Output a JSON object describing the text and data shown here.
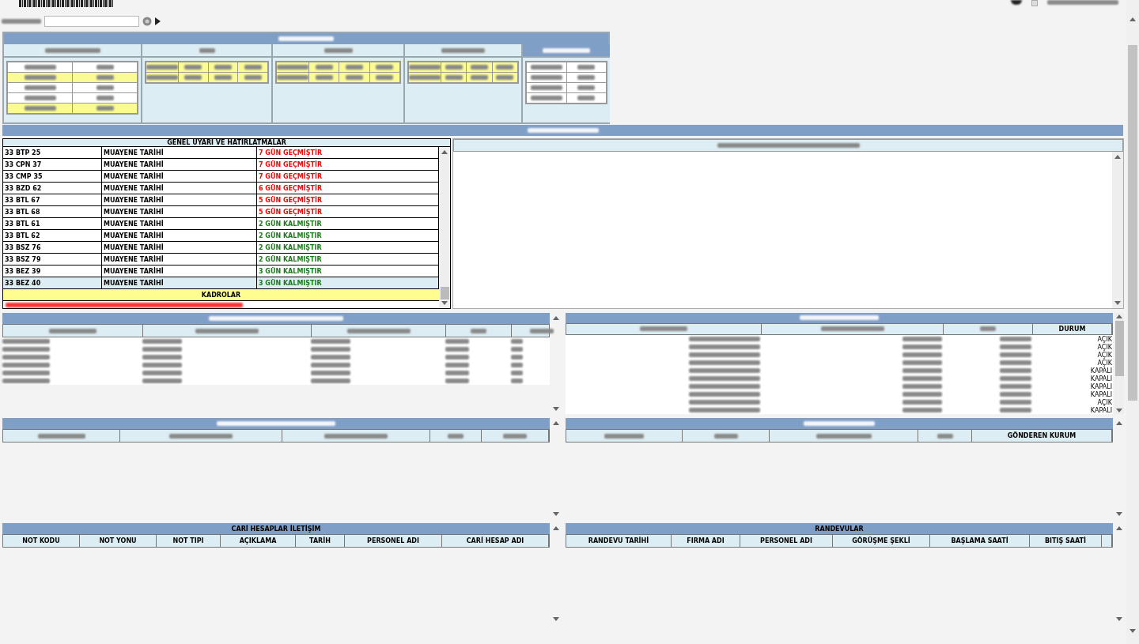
{
  "warnings": {
    "title": "GENEL UYARI VE HATIRLATMALAR",
    "rows": [
      {
        "plate": "33 BTP 25",
        "type": "MUAYENE TARİHİ",
        "status": "7 GÜN GEÇMİŞTİR",
        "color": "#ff0000",
        "selected": false
      },
      {
        "plate": "33 CPN 37",
        "type": "MUAYENE TARİHİ",
        "status": "7 GÜN GEÇMİŞTİR",
        "color": "#ff0000",
        "selected": false
      },
      {
        "plate": "33 CMP 35",
        "type": "MUAYENE TARİHİ",
        "status": "7 GÜN GEÇMİŞTİR",
        "color": "#ff0000",
        "selected": false
      },
      {
        "plate": "33 BZD 62",
        "type": "MUAYENE TARİHİ",
        "status": "6 GÜN GEÇMİŞTİR",
        "color": "#ff0000",
        "selected": false
      },
      {
        "plate": "33 BTL 67",
        "type": "MUAYENE TARİHİ",
        "status": "5 GÜN GEÇMİŞTİR",
        "color": "#ff0000",
        "selected": false
      },
      {
        "plate": "33 BTL 68",
        "type": "MUAYENE TARİHİ",
        "status": "5 GÜN GEÇMİŞTİR",
        "color": "#ff0000",
        "selected": false
      },
      {
        "plate": "33 BTL 61",
        "type": "MUAYENE TARİHİ",
        "status": "2 GÜN KALMIŞTIR",
        "color": "#1a7a1a",
        "selected": false
      },
      {
        "plate": "33 BTL 62",
        "type": "MUAYENE TARİHİ",
        "status": "2 GÜN KALMIŞTIR",
        "color": "#1a7a1a",
        "selected": false
      },
      {
        "plate": "33 BSZ 76",
        "type": "MUAYENE TARİHİ",
        "status": "2 GÜN KALMIŞTIR",
        "color": "#1a7a1a",
        "selected": false
      },
      {
        "plate": "33 BSZ 79",
        "type": "MUAYENE TARİHİ",
        "status": "2 GÜN KALMIŞTIR",
        "color": "#1a7a1a",
        "selected": false
      },
      {
        "plate": "33 BEZ 39",
        "type": "MUAYENE TARİHİ",
        "status": "3 GÜN KALMIŞTIR",
        "color": "#1a7a1a",
        "selected": false
      },
      {
        "plate": "33 BEZ 40",
        "type": "MUAYENE TARİHİ",
        "status": "3 GÜN KALMIŞTIR",
        "color": "#1a7a1a",
        "selected": true
      }
    ],
    "section": "KADROLAR"
  },
  "prepared_tasks": {
    "status_column": "DURUM",
    "statuses": [
      "AÇIK",
      "AÇIK",
      "AÇIK",
      "AÇIK",
      "KAPALI",
      "KAPALI",
      "KAPALI",
      "KAPALI",
      "AÇIK",
      "KAPALI"
    ]
  },
  "top_checkbox": {
    "checked": false
  },
  "announcements": {
    "last_column": "GÖNDEREN KURUM"
  },
  "contacts": {
    "title": "CARİ HESAPLAR İLETİŞİM",
    "columns": [
      "NOT KODU",
      "NOT YONU",
      "NOT TIPI",
      "AÇIKLAMA",
      "TARİH",
      "PERSONEL ADI",
      "CARİ HESAP ADI"
    ]
  },
  "appointments": {
    "title": "RANDEVULAR",
    "columns": [
      "RANDEVU TARİHİ",
      "FIRMA ADI",
      "PERSONEL ADI",
      "GÖRÜŞME ŞEKLİ",
      "BAŞLAMA SAATİ",
      "BITIŞ SAATİ"
    ]
  }
}
